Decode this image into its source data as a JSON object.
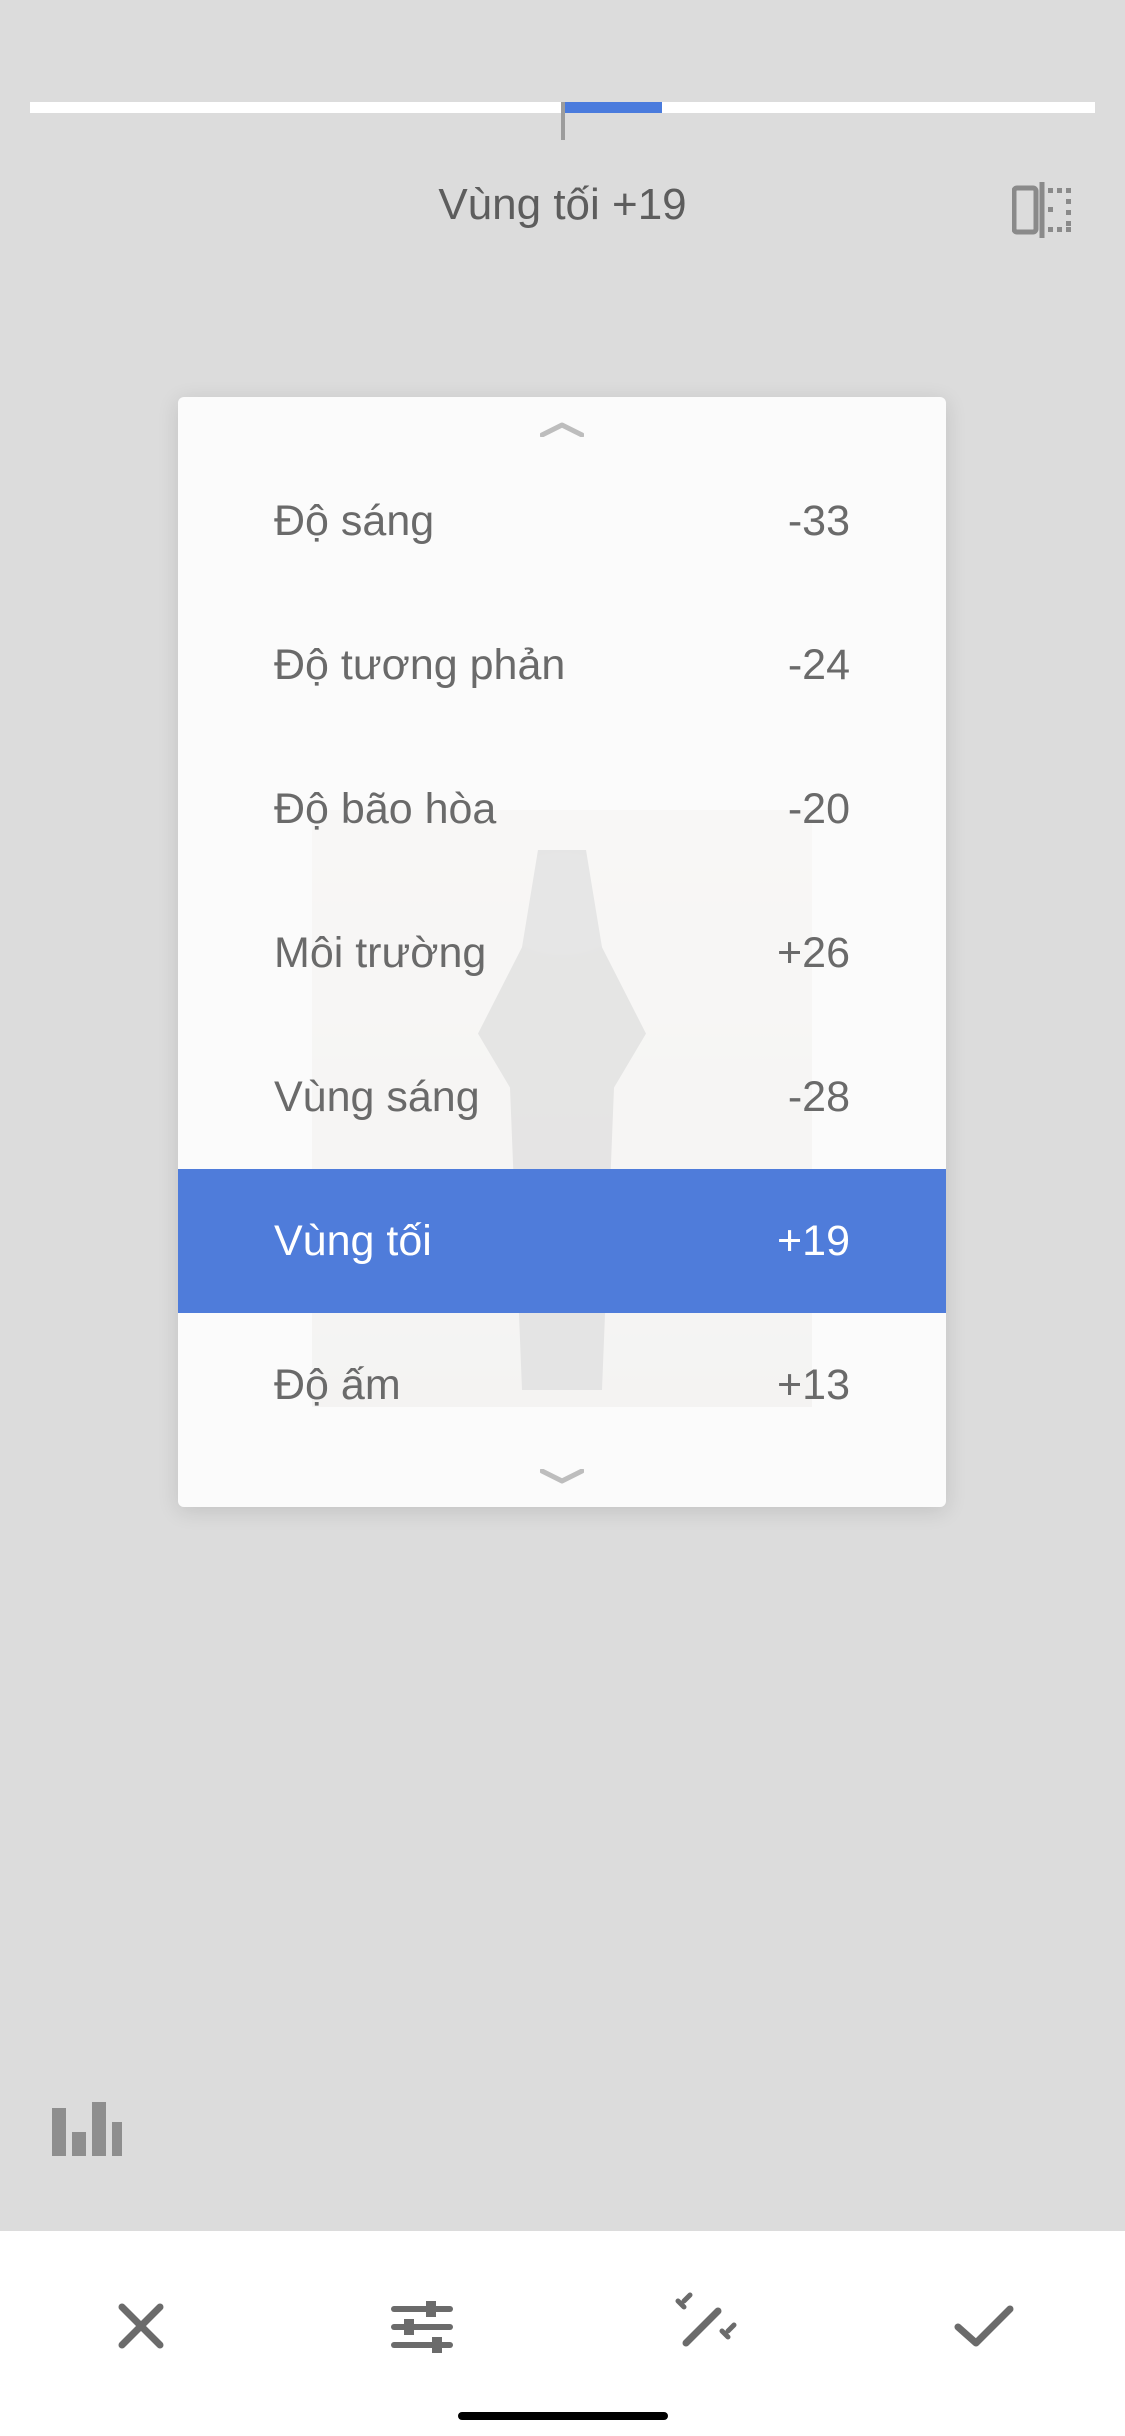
{
  "colors": {
    "accent": "#4f7cda",
    "background": "#dcdcdc",
    "panel": "rgba(255,255,255,0.87)"
  },
  "current": {
    "label": "Vùng tối",
    "value": "+19",
    "display": "Vùng tối +19"
  },
  "slider": {
    "min": -100,
    "max": 100,
    "value": 19
  },
  "params": [
    {
      "label": "Độ sáng",
      "value": "-33",
      "selected": false
    },
    {
      "label": "Độ tương phản",
      "value": "-24",
      "selected": false
    },
    {
      "label": "Độ bão hòa",
      "value": "-20",
      "selected": false
    },
    {
      "label": "Môi trường",
      "value": "+26",
      "selected": false
    },
    {
      "label": "Vùng sáng",
      "value": "-28",
      "selected": false
    },
    {
      "label": "Vùng tối",
      "value": "+19",
      "selected": true
    },
    {
      "label": "Độ ấm",
      "value": "+13",
      "selected": false
    }
  ],
  "icons": {
    "compare": "compare-icon",
    "histogram": "histogram-icon",
    "cancel": "close-icon",
    "adjust": "sliders-icon",
    "magic": "magic-wand-icon",
    "confirm": "check-icon",
    "chevron_up": "chevron-up-icon",
    "chevron_down": "chevron-down-icon"
  }
}
